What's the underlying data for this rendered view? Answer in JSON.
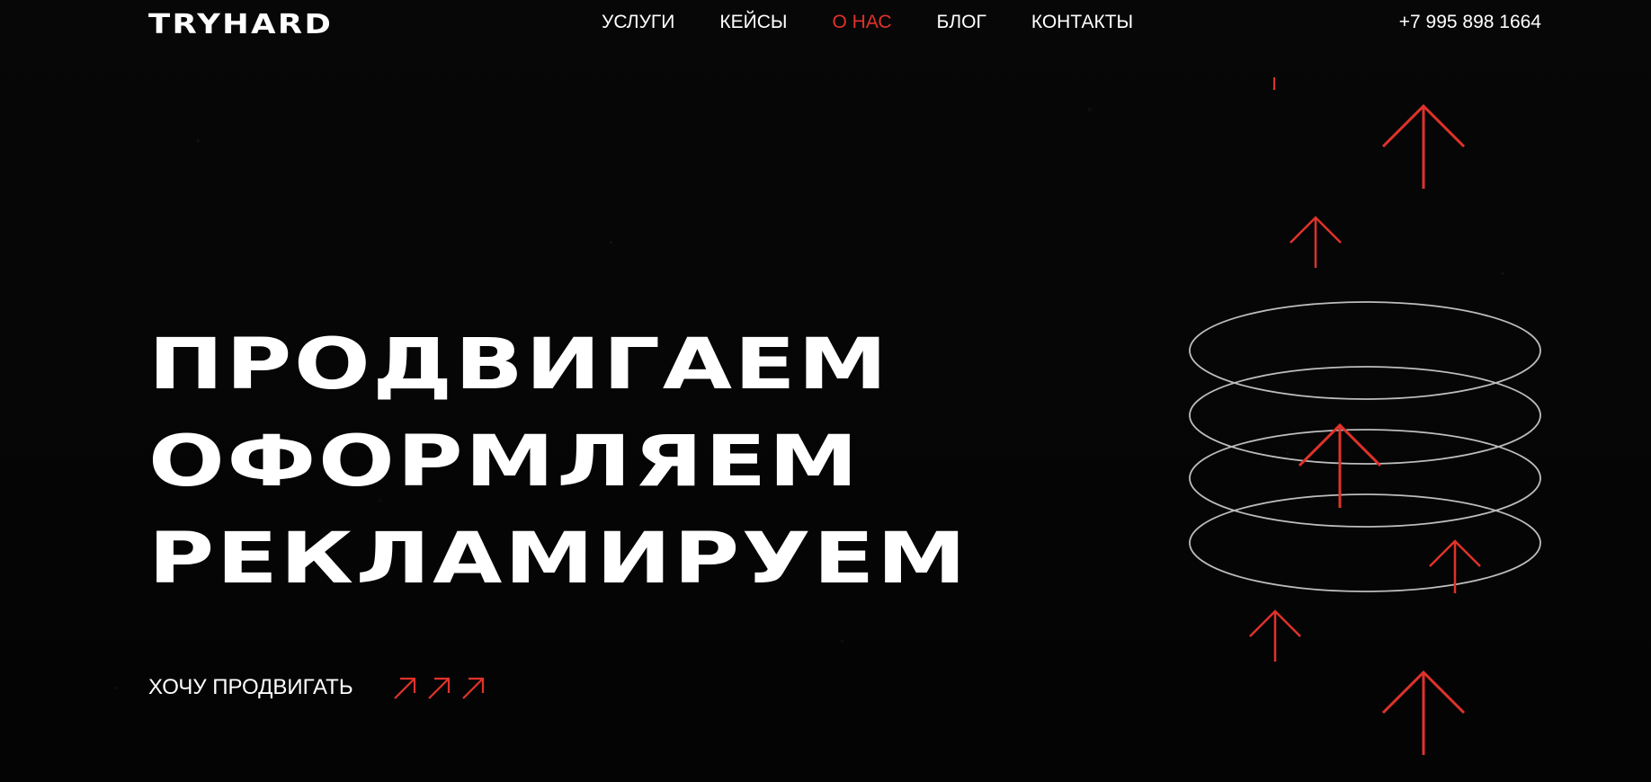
{
  "header": {
    "logo": "TRYHARD",
    "nav": [
      {
        "label": "УСЛУГИ",
        "active": false
      },
      {
        "label": "КЕЙСЫ",
        "active": false
      },
      {
        "label": "О НАС",
        "active": true
      },
      {
        "label": "БЛОГ",
        "active": false
      },
      {
        "label": "КОНТАКТЫ",
        "active": false
      }
    ],
    "phone": "+7 995 898 1664"
  },
  "hero": {
    "lines": [
      "ПРОДВИГАЕМ",
      "ОФОРМЛЯЕМ",
      "РЕКЛАМИРУЕМ"
    ],
    "cta_label": "ХОЧУ ПРОДВИГАТЬ",
    "cta_icon": "arrow-up-right-icon"
  },
  "visual": {
    "ring_icon": "ellipse-ring",
    "arrow_icon": "arrow-up-icon"
  },
  "colors": {
    "background": "#050505",
    "text": "#ffffff",
    "accent": "#e0322b",
    "ring": "#bdbdbd"
  }
}
